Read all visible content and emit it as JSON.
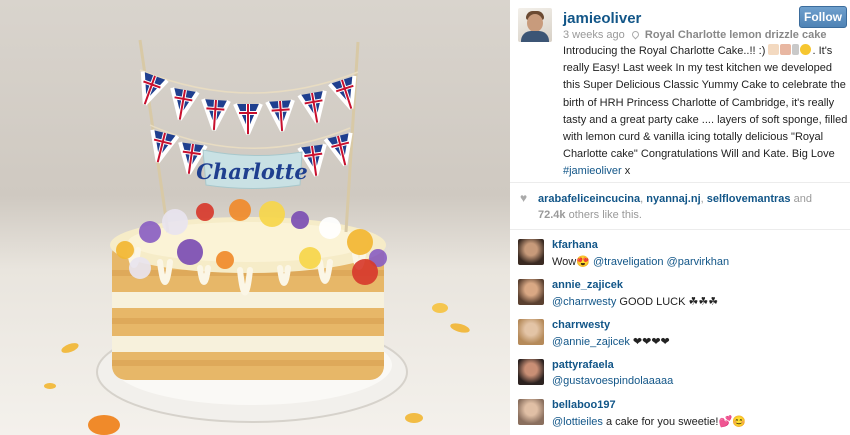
{
  "post": {
    "username": "jamieoliver",
    "follow_label": "Follow",
    "time_ago": "3 weeks ago",
    "location": "Royal Charlotte lemon drizzle cake",
    "caption_before_emoji": "Introducing the Royal Charlotte Cake..!! :)",
    "caption_after_emoji": "It's really Easy! Last week In my test kitchen we developed this Super Delicious Classic Yummy Cake to celebrate the birth of HRH Princess Charlotte of Cambridge, it's really tasty and a great party cake .... layers of soft sponge, filled with lemon curd & vanilla icing totally delicious \"Royal Charlotte cake\" Congratulations Will and Kate. Big Love",
    "caption_hashtag": "#jamieoliver",
    "caption_end": " x",
    "caption_emoji_icons": [
      "cake-icon",
      "birthday-cake-icon",
      "cutlery-icon",
      "grin-emoji-icon"
    ]
  },
  "photo": {
    "banner_text": "Charlotte"
  },
  "likes": {
    "users": [
      "arabafeliceincucina",
      "nyannaj.nj",
      "selflovemantras"
    ],
    "separator": ", ",
    "and_text": " and ",
    "count": "72.4k",
    "suffix": " others like this."
  },
  "comments": [
    {
      "user": "kfarhana",
      "text_prefix": "Wow😍 ",
      "mentions": [
        "@traveligation",
        "@parvirkhan"
      ],
      "text_suffix": ""
    },
    {
      "user": "annie_zajicek",
      "text_prefix": "",
      "mentions": [
        "@charrwesty"
      ],
      "text_suffix": " GOOD LUCK ☘☘☘"
    },
    {
      "user": "charrwesty",
      "text_prefix": "",
      "mentions": [
        "@annie_zajicek"
      ],
      "text_suffix": " ❤❤❤❤"
    },
    {
      "user": "pattyrafaela",
      "text_prefix": "",
      "mentions": [
        "@gustavoespindolaaaaa"
      ],
      "text_suffix": ""
    },
    {
      "user": "bellaboo197",
      "text_prefix": "",
      "mentions": [
        "@lottieiles"
      ],
      "text_suffix": " a cake for you sweetie!💕😊"
    }
  ],
  "colors": {
    "link": "#125688",
    "follow_button": "#5b8fc0",
    "muted": "#999999",
    "flag_red": "#c8102e",
    "flag_blue": "#1f3f8f"
  }
}
